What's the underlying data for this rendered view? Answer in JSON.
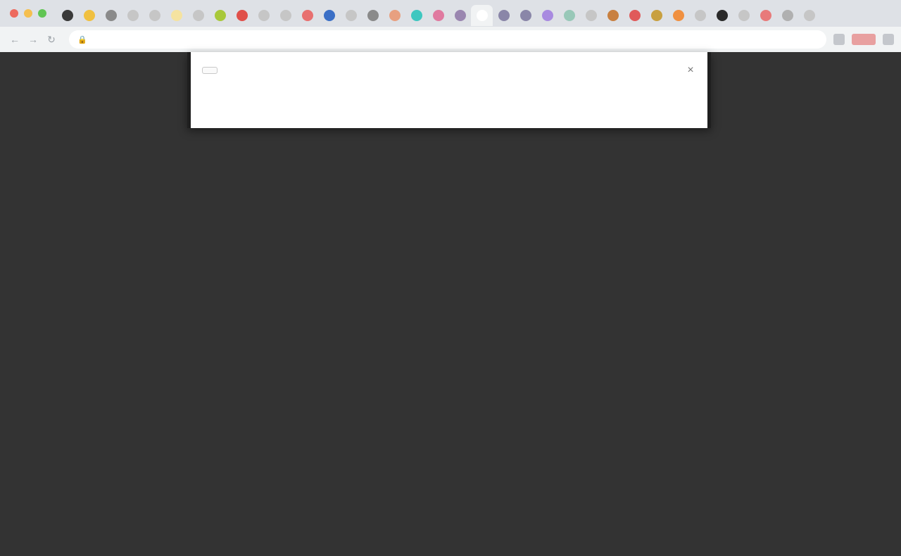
{
  "browser": {
    "traffic_lights": [
      "#ed6a5e",
      "#f5bf4f",
      "#61c554"
    ],
    "tab_favicons": [
      "#3a3a3a",
      "#f0c040",
      "#8a8a8a",
      "#c6c6c6",
      "#c6c6c6",
      "#f5e3a0",
      "#c6c6c6",
      "#a8c83a",
      "#e0504a",
      "#c6c6c6",
      "#c6c6c6",
      "#e87070",
      "#3b6fc6",
      "#c6c6c6",
      "#8a8a8a",
      "#e8a080",
      "#3ec7c0",
      "#e07aa0",
      "#9a86b0",
      "#ffffff",
      "#8a86a8",
      "#8a86a8",
      "#a88ae0",
      "#98c8b8",
      "#c6c6c6",
      "#c88040",
      "#e05a5a",
      "#c8a040",
      "#f09040",
      "#c6c6c6",
      "#2a2a2a",
      "#c6c6c6",
      "#e87a7a",
      "#b0b0b0",
      "#c6c6c6"
    ],
    "active_tab_index": 19,
    "address": "",
    "back_icon": "back-arrow-icon",
    "forward_icon": "forward-arrow-icon",
    "reload_icon": "reload-icon"
  },
  "popup": {
    "title": "",
    "text": ""
  },
  "page": {
    "center_text": ""
  }
}
